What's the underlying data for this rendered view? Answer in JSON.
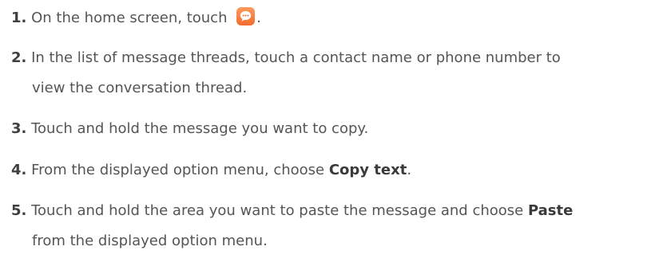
{
  "steps": [
    {
      "number": "1.",
      "text_before": "On the home screen, touch",
      "icon": "messaging-app-icon",
      "text_after": "."
    },
    {
      "number": "2.",
      "line1": "In the list of message threads, touch a contact name or phone number to",
      "line2": "view the conversation thread."
    },
    {
      "number": "3.",
      "text": "Touch and hold the message you want to copy."
    },
    {
      "number": "4.",
      "text_before": "From the displayed option menu, choose ",
      "bold": "Copy text",
      "text_after": "."
    },
    {
      "number": "5.",
      "line1_before": "Touch and hold the area you want to paste the message and choose ",
      "bold": "Paste",
      "line2": "from the displayed option menu."
    }
  ],
  "colors": {
    "text": "#555555",
    "number": "#3f3f3f",
    "icon_orange": "#f26a2e"
  }
}
